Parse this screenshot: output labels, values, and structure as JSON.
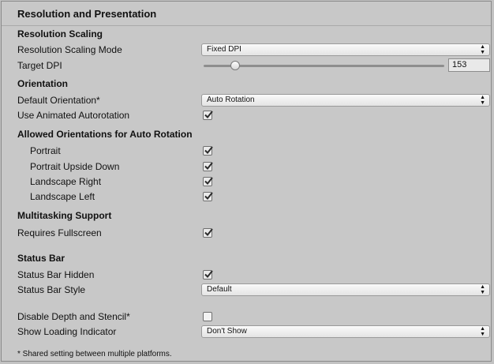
{
  "header": {
    "title": "Resolution and Presentation"
  },
  "resolution_scaling": {
    "title": "Resolution Scaling",
    "mode_label": "Resolution Scaling Mode",
    "mode_value": "Fixed DPI",
    "target_dpi_label": "Target DPI",
    "target_dpi_value": "153",
    "target_dpi_slider_fraction": 0.13
  },
  "orientation": {
    "title": "Orientation",
    "default_label": "Default Orientation*",
    "default_value": "Auto Rotation",
    "animated_label": "Use Animated Autorotation",
    "animated_checked": true
  },
  "allowed": {
    "title": "Allowed Orientations for Auto Rotation",
    "items": [
      {
        "label": "Portrait",
        "checked": true
      },
      {
        "label": "Portrait Upside Down",
        "checked": true
      },
      {
        "label": "Landscape Right",
        "checked": true
      },
      {
        "label": "Landscape Left",
        "checked": true
      }
    ]
  },
  "multitasking": {
    "title": "Multitasking Support",
    "fullscreen_label": "Requires Fullscreen",
    "fullscreen_checked": true
  },
  "status_bar": {
    "title": "Status Bar",
    "hidden_label": "Status Bar Hidden",
    "hidden_checked": true,
    "style_label": "Status Bar Style",
    "style_value": "Default"
  },
  "misc": {
    "depth_label": "Disable Depth and Stencil*",
    "depth_checked": false,
    "loading_label": "Show Loading Indicator",
    "loading_value": "Don't Show"
  },
  "footnote": "* Shared setting between multiple platforms.",
  "icons": {
    "dropdown_arrow": "updown-arrow-icon",
    "checkmark": "checkmark-icon"
  }
}
